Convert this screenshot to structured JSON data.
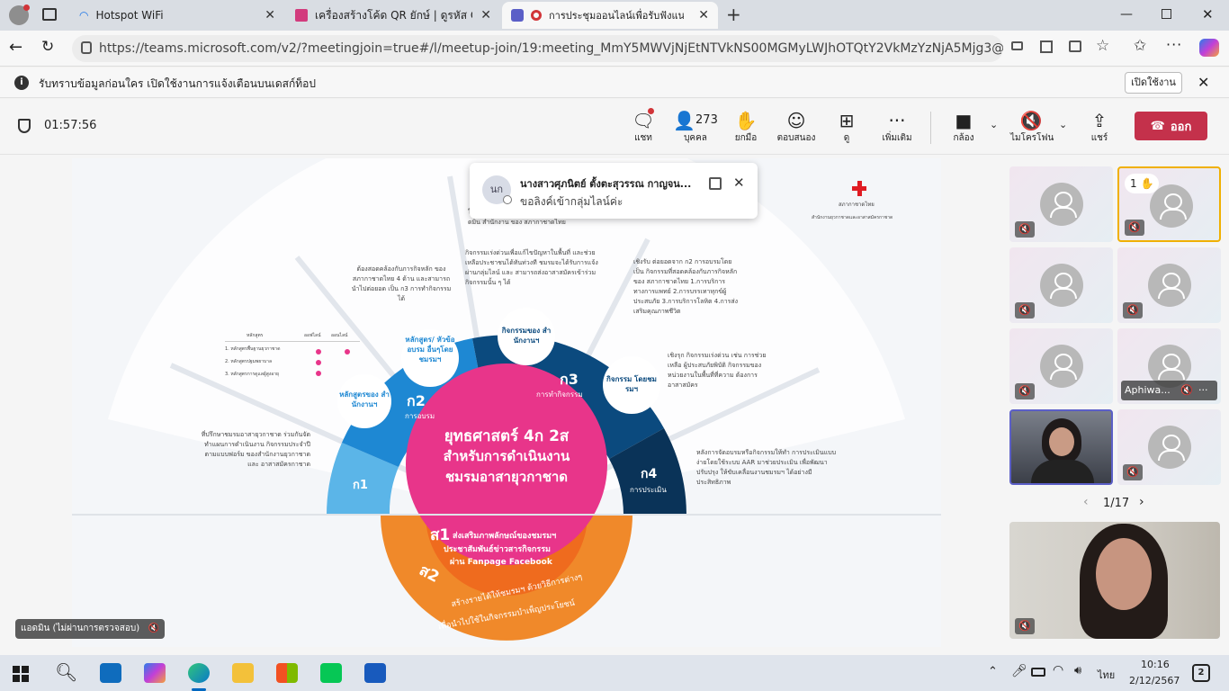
{
  "tabs": [
    {
      "title": "Hotspot WiFi"
    },
    {
      "title": "เครื่องสร้างโค้ด QR ยักษ์ | ดูรหัส QR"
    },
    {
      "title": "การประชุมออนไลน์เพื่อรับฟังแนวท"
    }
  ],
  "address": {
    "url": "https://teams.microsoft.com/v2/?meetingjoin=true#/l/meetup-join/19:meeting_MmY5MWVjNjEtNTVkNS00MGMyLWJhOTQtY2VkMzYzNjA5Mjg3@thread.v2/0?..."
  },
  "notification": {
    "text": "รับทราบข้อมูลก่อนใคร เปิดใช้งานการแจ้งเตือนบนเดสก์ท็อป",
    "button": "เปิดใช้งาน"
  },
  "meeting": {
    "timer": "01:57:56",
    "participants_count": "273",
    "buttons": {
      "chat": "แชท",
      "people": "บุคคล",
      "raise": "ยกมือ",
      "react": "ตอบสนอง",
      "view": "ดู",
      "more": "เพิ่มเติม",
      "camera": "กล้อง",
      "mic": "ไมโครโฟน",
      "share": "แชร์",
      "leave": "ออก"
    }
  },
  "popup": {
    "initials": "นก",
    "name": "นางสาวศุภนิตย์ ตั้งตะสุวรรณ กาญจน...",
    "message": "ขอลิงค์เข้ากลุ่มไลน์ค่ะ"
  },
  "slide": {
    "center_title": "ยุทธศาสตร์ 4ก 2ส",
    "center_sub1": "สำหรับการดำเนินงาน",
    "center_sub2": "ชมรมอาสายุวกาชาด",
    "k1": "ก1",
    "k2": "ก2",
    "k2_label": "การอบรม",
    "k3": "ก3",
    "k3_label": "การทำกิจกรรม",
    "k4": "ก4",
    "k4_label": "การประเมิน",
    "bubble_course_office": "หลักสูตรของ สำนักงานฯ",
    "bubble_course_club": "หลักสูตร/ หัวข้ออบรม อื่นๆโดย ชมรมฯ",
    "bubble_activity_office": "กิจกรรมของ สำนักงานฯ",
    "bubble_activity_club": "กิจกรรม โดยชมรมฯ",
    "s1": "ส1",
    "s1_text1": "ส่งเสริมภาพลักษณ์ของชมรมฯ",
    "s1_text2": "ประชาสัมพันธ์ข่าวสารกิจกรรม",
    "s1_text3": "ผ่าน Fanpage Facebook",
    "s2": "ส2",
    "s2_text1": "สร้างรายได้ให้ชมรมฯ ด้วยวิธีการต่างๆ",
    "s2_text2": "เพื่อนำไปใช้ในกิจกรรมบำเพ็ญประโยชน์",
    "logo_org": "สภากาชาดไทย",
    "logo_sub": "สำนักงานยุวกาชาดและอาสาสมัครกาชาด",
    "text_left": "ที่ปรึกษาชมรมอาสายุวกาชาด ร่วมกันจัดทำแผนการดำเนินงาน กิจกรรมประจำปีตามแบบฟอร์ม ของสำนักงานยุวกาชาดและ อาสาสมัครกาชาด",
    "text_k2": "ต้องสอดคล้องกับภารกิจหลัก ของสภากาชาดไทย 4 ด้าน และสามารถนำไปต่อยอด เป็น ก3 การทำกิจกรรมได้",
    "text_k3a": "กิจกรรมเร่งด่วนเพื่อแก้ไขปัญหาในพื้นที่ และช่วยเหลือประชาชนได้ทันท่วงที ชมรมจะได้รับการแจ้งผ่านกลุ่มไลน์ และ สามารถส่งอาสาสมัครเข้าร่วมกิจกรรมนั้น ๆ ได้",
    "text_k3b": "เชิงรับ ต่อยอดจาก ก2 การอบรมโดยเป็น กิจกรรมที่สอดคล้องกับภารกิจหลักของ สภากาชาดไทย 1.การบริการทางการแพทย์ 2.การบรรเทาทุกข์ผู้ประสบภัย 3.การบริการโลหิต 4.การส่งเสริมคุณภาพชีวิต",
    "text_k3c": "เชิงรุก กิจกรรมเร่งด่วน เช่น การช่วยเหลือ ผู้ประสบภัยพิบัติ กิจกรรมของ หน่วยงานในพื้นที่ที่ความ ต้องการอาสาสมัคร",
    "text_k4": "หลังการจัดอบรมหรือกิจกรรมให้ทำ การประเมินแบบง่ายโดยใช้ระบบ AAR มาช่วยประเมิน เพื่อพัฒนา ปรับปรุง ให้ขับเคลื่อนงานชมรมฯ ได้อย่างมีประสิทธิภาพ",
    "text_top": "ใช้กระบวนการของการจัดตั้งกิจกรรม กลุ่มไลน์แอดมิน สำนักงาน ของ สภากาชาดไทย",
    "table_header": [
      "หลักสูตร",
      "ออฟไลน์",
      "ออนไลน์"
    ],
    "table_rows": [
      "1. หลักสูตรพื้นฐานยุวกาชาด",
      "2. หลักสูตรปฐมพยาบาล",
      "3. หลักสูตรการดูแลผู้สูงอายุ"
    ]
  },
  "tiles": {
    "raise_count": "1",
    "named_tile": "Aphiwa...",
    "pager": "1/17"
  },
  "presenter_label": "แอดมิน (ไม่ผ่านการตรวจสอบ)",
  "taskbar": {
    "lang": "ไทย",
    "time": "10:16",
    "date": "2/12/2567",
    "notif_count": "2"
  },
  "colors": {
    "accent": "#c4314b",
    "teams": "#5b5fc7",
    "pink": "#e8358a",
    "navy": "#0b4a7e",
    "blue": "#1e88d3",
    "orange": "#f0892a"
  }
}
